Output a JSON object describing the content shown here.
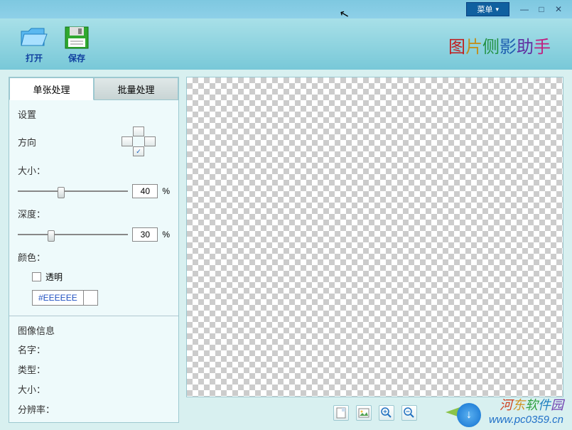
{
  "titlebar": {
    "menu_label": "菜单"
  },
  "toolbar": {
    "open_label": "打开",
    "save_label": "保存",
    "app_title_chars": [
      "图",
      "片",
      "侧",
      "影",
      "助",
      "手"
    ]
  },
  "tabs": {
    "single": "单张处理",
    "batch": "批量处理"
  },
  "settings": {
    "section": "设置",
    "direction_label": "方向",
    "direction_selected": "down",
    "size_label": "大小：",
    "size_value": "40",
    "depth_label": "深度：",
    "depth_value": "30",
    "percent": "%",
    "color_label": "颜色：",
    "transparent_label": "透明",
    "color_hex": "#EEEEEE"
  },
  "image_info": {
    "section": "图像信息",
    "name_label": "名字：",
    "type_label": "类型：",
    "size_label": "大小：",
    "resolution_label": "分辨率：",
    "name_value": "",
    "type_value": "",
    "size_value": "",
    "resolution_value": ""
  },
  "bottom_tools": {
    "new_icon": "new",
    "image_icon": "image",
    "zoom_in_icon": "zoom-in",
    "zoom_out_icon": "zoom-out"
  },
  "watermark": {
    "site_name": "河东软件园",
    "url": "www.pc0359.cn"
  }
}
